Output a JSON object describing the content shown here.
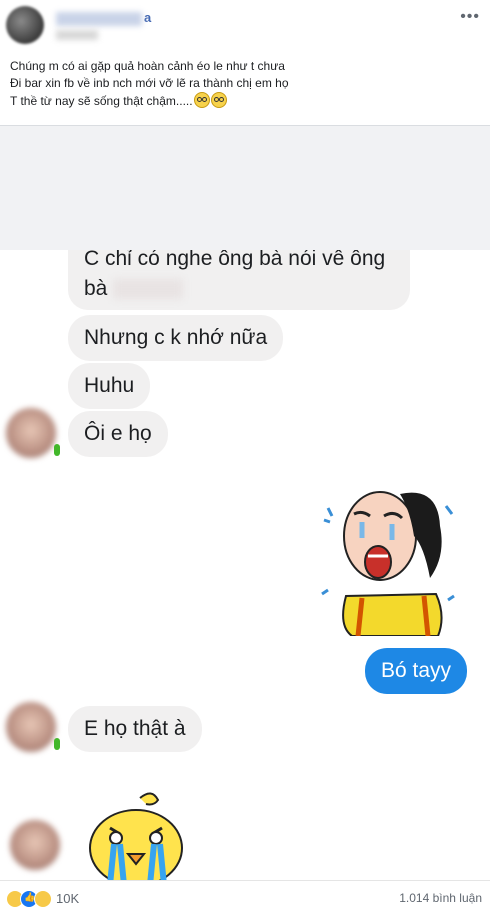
{
  "post": {
    "author_visible_suffix": "a",
    "more_label": "•••",
    "caption": "Chúng m có ai gặp quả hoàn cảnh éo le như t chưa\nĐi bar xin fb về inb nch mới vỡ lẽ ra thành chị em họ \nT thề từ nay sẽ sống thật chậm....."
  },
  "chat": {
    "messages": [
      {
        "side": "left",
        "text_line1": "C chỉ có nghe ông bà nói vê ông",
        "text_line2_prefix": "bà "
      },
      {
        "side": "left",
        "text": "Nhưng c k nhớ nữa"
      },
      {
        "side": "left",
        "text": "Huhu"
      },
      {
        "side": "left",
        "text": "Ôi e họ"
      },
      {
        "side": "right",
        "text": "Bó tayy"
      },
      {
        "side": "left",
        "text": "E họ thật à"
      }
    ],
    "colors": {
      "incoming_bubble": "#f1f0f0",
      "outgoing_bubble": "#1e88e5"
    }
  },
  "footer": {
    "reaction_icons": [
      "haha-icon",
      "like-icon",
      "sad-icon"
    ],
    "reaction_count": "10K",
    "comments_label": "1.014 bình luận"
  }
}
